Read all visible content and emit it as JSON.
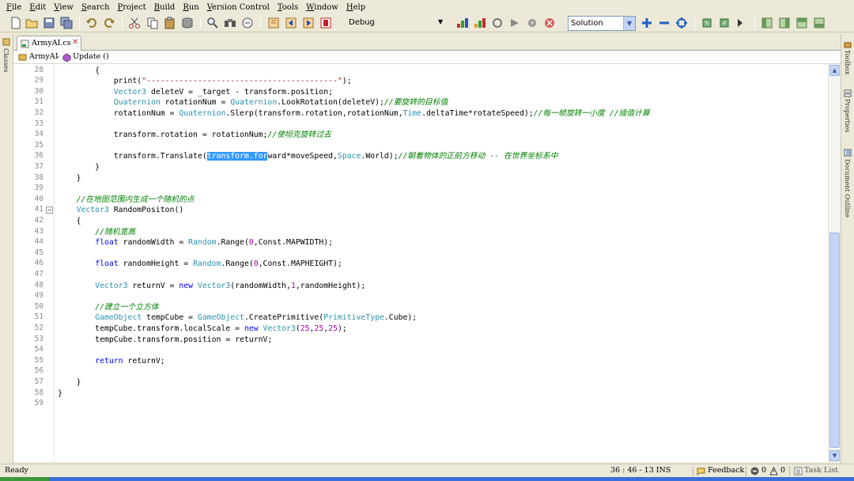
{
  "menu": [
    "File",
    "Edit",
    "View",
    "Search",
    "Project",
    "Build",
    "Run",
    "Version Control",
    "Tools",
    "Window",
    "Help"
  ],
  "toolbar": {
    "configuration": "Debug",
    "solution_selector": "Solution"
  },
  "left_dock": {
    "classes_label": "Classes"
  },
  "right_dock": {
    "toolbox_label": "Toolbox",
    "properties_label": "Properties",
    "document_outline_label": "Document Outline"
  },
  "document": {
    "tab_name": "ArmyAI.cs",
    "close_glyph": "✕",
    "breadcrumb": {
      "class_name": "ArmyAI",
      "method_name": "Update ()"
    }
  },
  "editor": {
    "lines": [
      {
        "n": "28",
        "text": "        {"
      },
      {
        "n": "29",
        "text": "            print(\"-----------------------------------------\");"
      },
      {
        "n": "30",
        "text": "            Vector3 deleteV = _target - transform.position;"
      },
      {
        "n": "31",
        "text": "            Quaternion rotationNum = Quaternion.LookRotation(deleteV);//要旋转的目标值"
      },
      {
        "n": "32",
        "text": "            rotationNum = Quaternion.Slerp(transform.rotation,rotationNum,Time.deltaTime*rotateSpeed);//每一帧旋转一小度 //插值计算"
      },
      {
        "n": "33",
        "text": ""
      },
      {
        "n": "34",
        "text": "            transform.rotation = rotationNum;//使坦克旋转过去"
      },
      {
        "n": "35",
        "text": ""
      },
      {
        "n": "36",
        "text": "            transform.Translate(transform.forward*moveSpeed,Space.World);//朝着物体的正前方移动 -- 在世界坐标系中"
      },
      {
        "n": "37",
        "text": "        }"
      },
      {
        "n": "38",
        "text": "    }"
      },
      {
        "n": "39",
        "text": ""
      },
      {
        "n": "40",
        "text": "    //在地图范围内生成一个随机的点"
      },
      {
        "n": "41",
        "text": "    Vector3 RandomPositon()"
      },
      {
        "n": "42",
        "text": "    {"
      },
      {
        "n": "43",
        "text": "        //随机宽高"
      },
      {
        "n": "44",
        "text": "        float randomWidth = Random.Range(0,Const.MAPWIDTH);"
      },
      {
        "n": "45",
        "text": ""
      },
      {
        "n": "46",
        "text": "        float randomHeight = Random.Range(0,Const.MAPHEIGHT);"
      },
      {
        "n": "47",
        "text": ""
      },
      {
        "n": "48",
        "text": "        Vector3 returnV = new Vector3(randomWidth,1,randomHeight);"
      },
      {
        "n": "49",
        "text": ""
      },
      {
        "n": "50",
        "text": "        //建立一个立方体"
      },
      {
        "n": "51",
        "text": "        GameObject tempCube = GameObject.CreatePrimitive(PrimitiveType.Cube);"
      },
      {
        "n": "52",
        "text": "        tempCube.transform.localScale = new Vector3(25,25,25);"
      },
      {
        "n": "53",
        "text": "        tempCube.transform.position = returnV;"
      },
      {
        "n": "54",
        "text": ""
      },
      {
        "n": "55",
        "text": "        return returnV;"
      },
      {
        "n": "56",
        "text": ""
      },
      {
        "n": "57",
        "text": "    }"
      },
      {
        "n": "58",
        "text": "}"
      },
      {
        "n": "59",
        "text": ""
      }
    ],
    "selected_text": "transform.for"
  },
  "status": {
    "state": "Ready",
    "position": "36 : 46 - 13 INS",
    "feedback": "Feedback",
    "errors": "0",
    "warnings": "0",
    "task_list": "Task List"
  }
}
